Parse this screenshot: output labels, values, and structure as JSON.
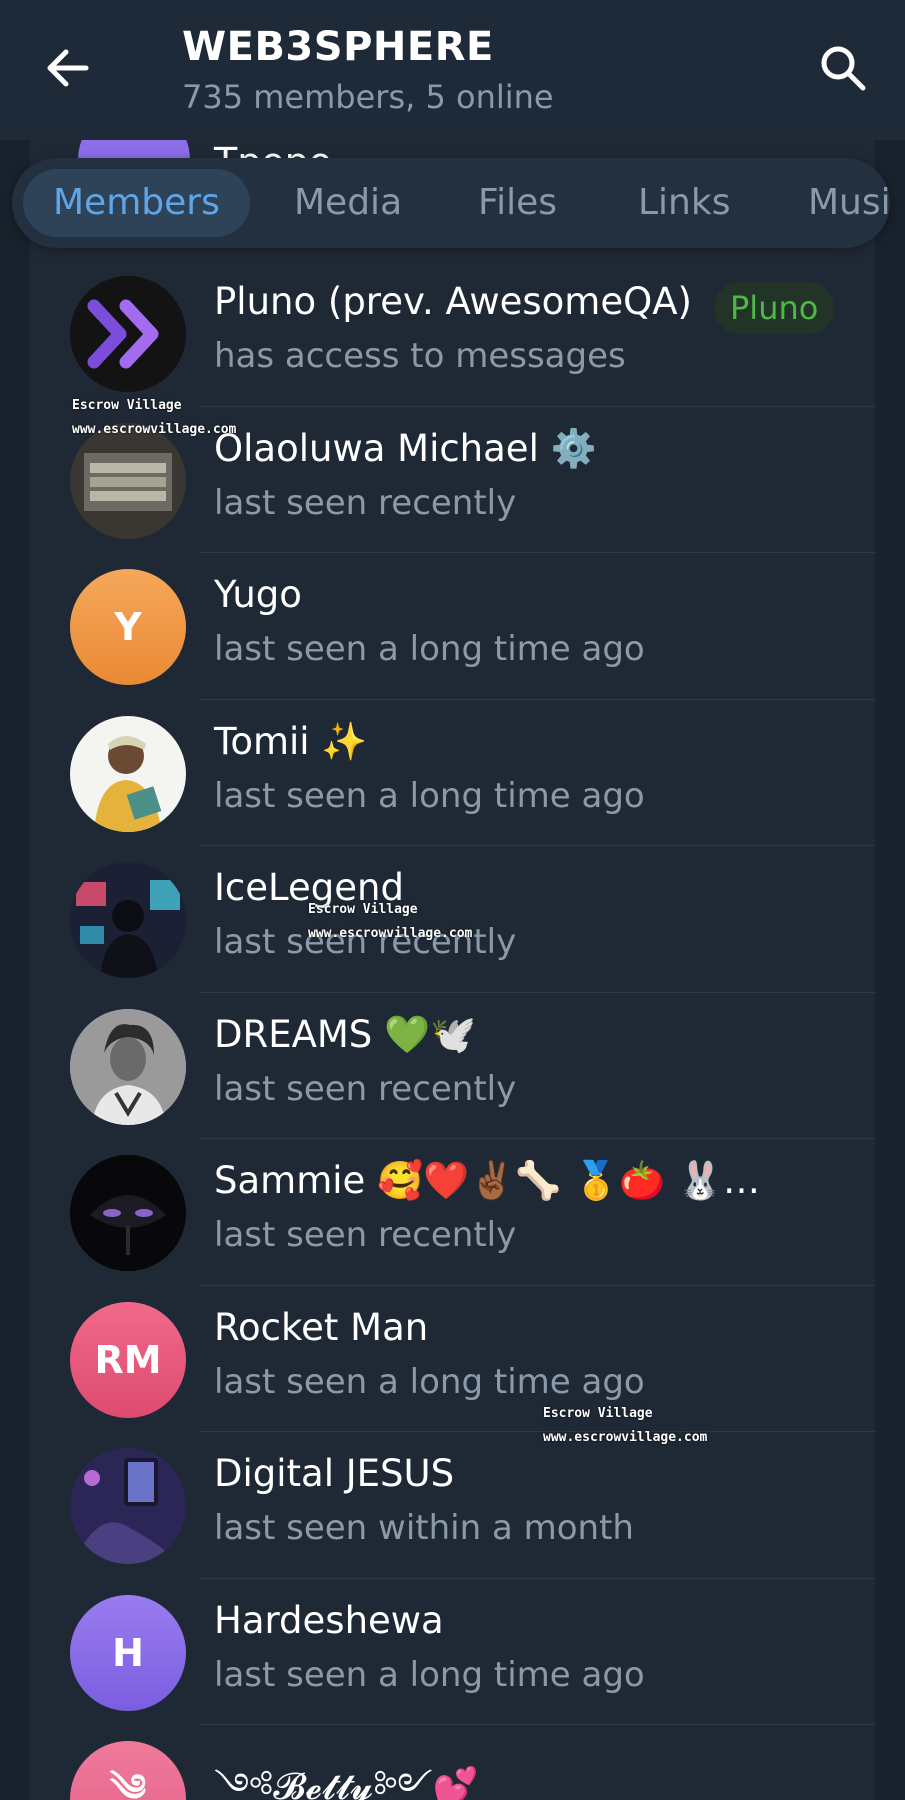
{
  "header": {
    "title": "WEB3SPHERE",
    "subtitle": "735 members, 5 online"
  },
  "peek": {
    "name": "Tpopo"
  },
  "tabs": [
    {
      "label": "Members",
      "active": true
    },
    {
      "label": "Media"
    },
    {
      "label": "Files"
    },
    {
      "label": "Links"
    },
    {
      "label": "Musi"
    }
  ],
  "members": [
    {
      "name": "Pluno (prev. AwesomeQA)",
      "status": "has access to messages",
      "badge": "Pluno",
      "avatar": "chevrons-logo"
    },
    {
      "name": "Olaoluwa Michael ⚙️",
      "status": "last seen recently",
      "avatar": "photo"
    },
    {
      "name": "Yugo",
      "status": "last seen a long time ago",
      "avatar_initials": "Y",
      "avatar_color": "#f29a47"
    },
    {
      "name": "Tomii ✨",
      "status": "last seen a long time ago",
      "avatar": "photo"
    },
    {
      "name": "IceLegend",
      "status": "last seen recently",
      "avatar": "photo"
    },
    {
      "name": "DREAMS 💚🕊️",
      "status": "last seen recently",
      "avatar": "photo"
    },
    {
      "name": "Sammie 🥰❤️✌🏾🦴 🥇🍅 🐰…",
      "status": "last seen recently",
      "avatar": "photo"
    },
    {
      "name": "Rocket Man",
      "status": "last seen a long time ago",
      "avatar_initials": "RM",
      "avatar_color": "#e8577a"
    },
    {
      "name": "Digital JESUS",
      "status": "last seen within a month",
      "avatar": "photo"
    },
    {
      "name": "Hardeshewa",
      "status": "last seen a long time ago",
      "avatar_initials": "H",
      "avatar_color": "#8a6de8"
    },
    {
      "name": "༺𝓑𝓮𝓽𝓽𝔂༻💕",
      "status": "",
      "avatar_initials": "༄",
      "avatar_color": "#e86e93"
    }
  ],
  "watermarks": [
    {
      "line1": "Escrow Village",
      "line2": "www.escrowvillage.com"
    },
    {
      "line1": "Escrow Village",
      "line2": "www.escrowvillage.com"
    },
    {
      "line1": "Escrow Village",
      "line2": "www.escrowvillage.com"
    }
  ]
}
